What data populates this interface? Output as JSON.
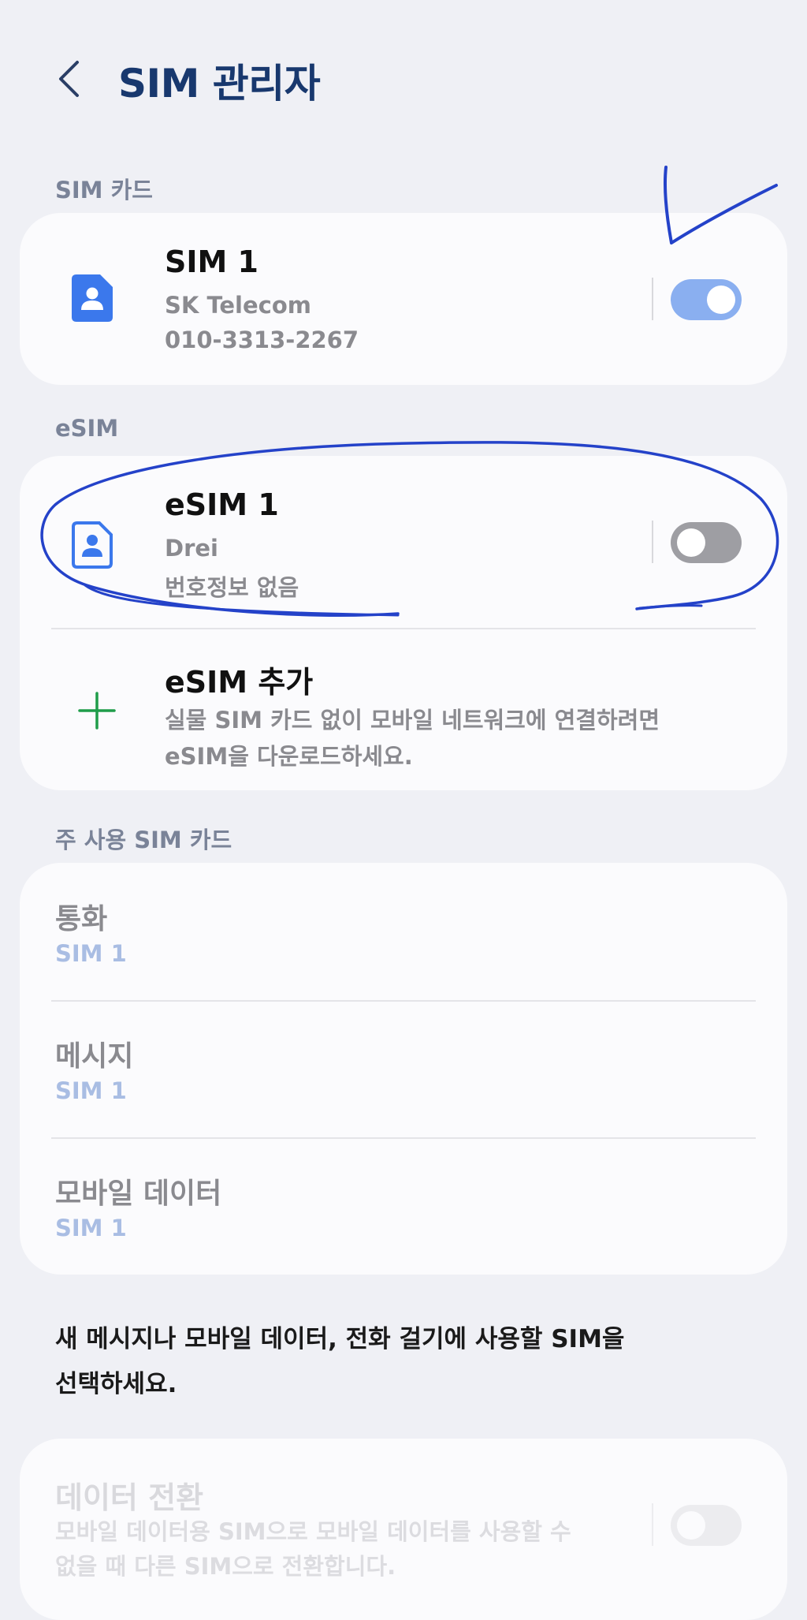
{
  "header": {
    "title": "SIM 관리자"
  },
  "sections": {
    "sim_card": "SIM 카드",
    "esim": "eSIM",
    "preferred": "주 사용 SIM 카드"
  },
  "sim1": {
    "title": "SIM 1",
    "carrier": "SK Telecom",
    "number": "010-3313-2267",
    "enabled": true
  },
  "esim1": {
    "title": "eSIM 1",
    "carrier": "Drei",
    "number": "번호정보 없음",
    "enabled": false
  },
  "add_esim": {
    "title": "eSIM 추가",
    "desc_line1": "실물 SIM 카드 없이 모바일 네트워크에 연결하려면",
    "desc_line2": "eSIM을 다운로드하세요."
  },
  "preferred": {
    "calls": {
      "title": "통화",
      "value": "SIM 1"
    },
    "messages": {
      "title": "메시지",
      "value": "SIM 1"
    },
    "mobile_data": {
      "title": "모바일 데이터",
      "value": "SIM 1"
    }
  },
  "note": {
    "line1": "새 메시지나 모바일 데이터, 전화 걸기에 사용할 SIM을",
    "line2": "선택하세요."
  },
  "data_switch": {
    "title": "데이터 전환",
    "desc_line1": "모바일 데이터용 SIM으로 모바일 데이터를 사용할 수",
    "desc_line2": "없을 때 다른 SIM으로 전환합니다.",
    "enabled": false
  },
  "colors": {
    "accent": "#3b6fe0",
    "title": "#18386e",
    "toggle_on": "#8aaff0",
    "annotation_ink": "#2442c9",
    "plus": "#1f9d4a"
  }
}
